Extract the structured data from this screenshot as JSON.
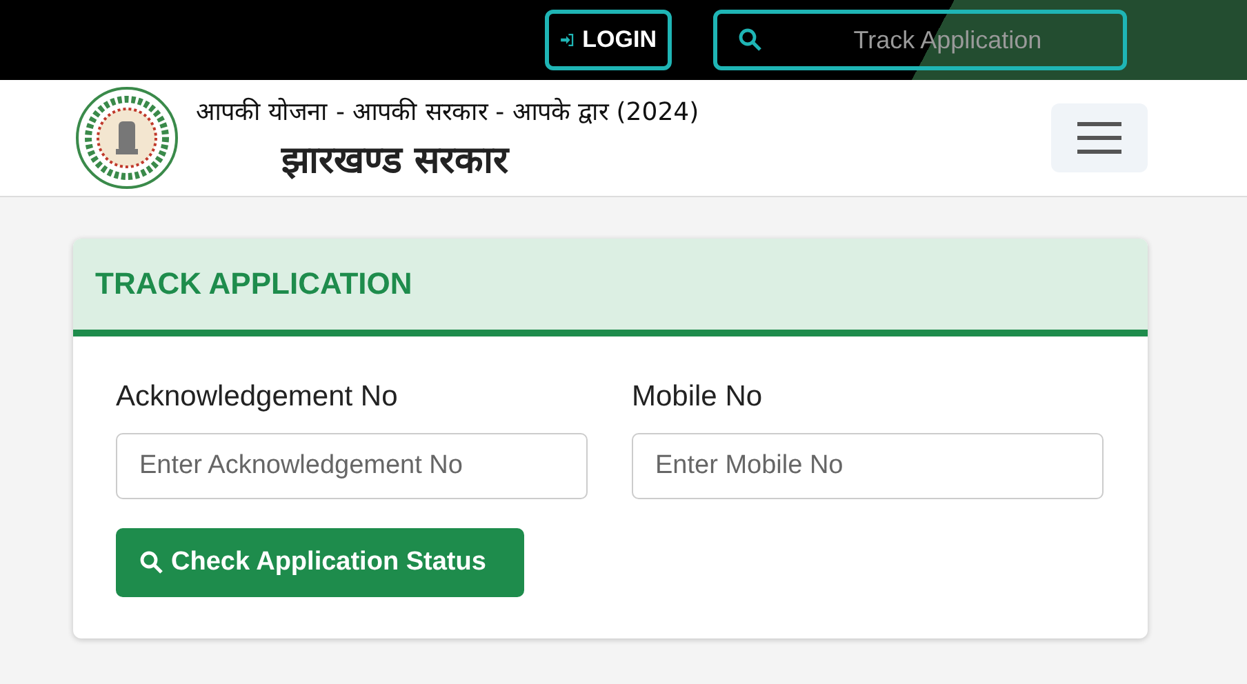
{
  "top_bar": {
    "login_button": "LOGIN",
    "search": {
      "placeholder": "Track Application"
    }
  },
  "header": {
    "tagline": "आपकी योजना - आपकी सरकार - आपके द्वार (2024)",
    "title": "झारखण्ड सरकार"
  },
  "card": {
    "title": "TRACK APPLICATION",
    "fields": [
      {
        "label": "Acknowledgement No",
        "placeholder": "Enter Acknowledgement No"
      },
      {
        "label": "Mobile No",
        "placeholder": "Enter Mobile No"
      }
    ],
    "button": "Check Application Status"
  }
}
